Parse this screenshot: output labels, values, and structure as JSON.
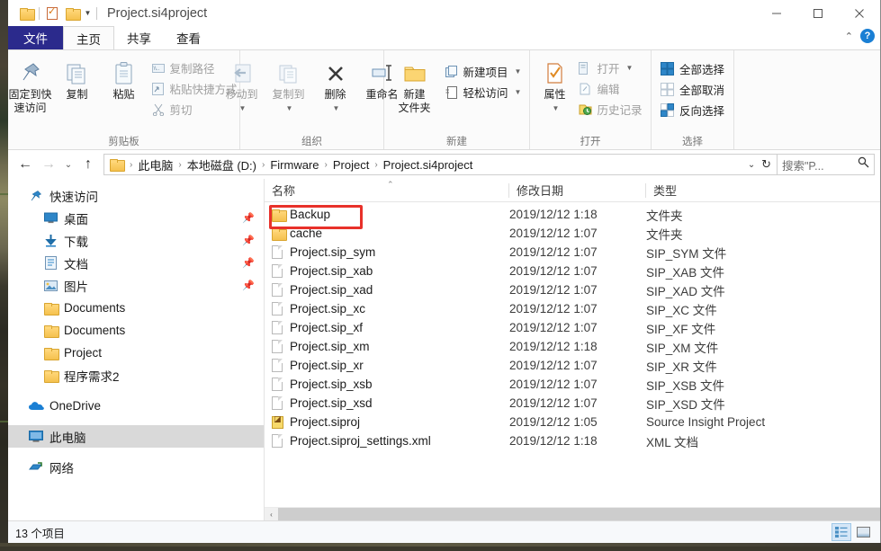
{
  "titlebar": {
    "title": "Project.si4project",
    "qat": [
      {
        "name": "folder-icon",
        "label": ""
      },
      {
        "name": "properties-icon",
        "label": ""
      },
      {
        "name": "new-folder-icon",
        "label": ""
      },
      {
        "name": "customize-caret-icon",
        "label": "▾"
      }
    ],
    "minimize": "—",
    "maximize": "□",
    "close": "✕"
  },
  "tabs": [
    {
      "label": "文件",
      "kind": "file"
    },
    {
      "label": "主页",
      "kind": "active"
    },
    {
      "label": "共享",
      "kind": "normal"
    },
    {
      "label": "查看",
      "kind": "normal"
    }
  ],
  "tabbar_right": {
    "collapse_ribbon": "⌃",
    "help": "?"
  },
  "ribbon": {
    "groups": [
      {
        "label": "剪贴板",
        "big": [
          {
            "label": "固定到快\n速访问",
            "icon": "pin-icon",
            "disabled": false
          },
          {
            "label": "复制",
            "icon": "copy-icon",
            "disabled": false
          },
          {
            "label": "粘贴",
            "icon": "paste-icon",
            "disabled": false
          }
        ],
        "small": [
          {
            "label": "复制路径",
            "icon": "copy-path-icon",
            "disabled": true
          },
          {
            "label": "粘贴快捷方式",
            "icon": "paste-shortcut-icon",
            "disabled": true
          },
          {
            "label": "剪切",
            "icon": "cut-icon",
            "disabled": true
          }
        ]
      },
      {
        "label": "组织",
        "big": [
          {
            "label": "移动到",
            "icon": "move-to-icon",
            "disabled": true,
            "caret": true
          },
          {
            "label": "复制到",
            "icon": "copy-to-icon",
            "disabled": true,
            "caret": true
          },
          {
            "label": "删除",
            "icon": "delete-icon",
            "disabled": false,
            "caret": true
          },
          {
            "label": "重命名",
            "icon": "rename-icon",
            "disabled": false
          }
        ],
        "small": []
      },
      {
        "label": "新建",
        "big": [
          {
            "label": "新建\n文件夹",
            "icon": "new-folder-icon",
            "disabled": false
          }
        ],
        "small": [
          {
            "label": "新建项目",
            "icon": "new-item-icon",
            "disabled": false,
            "caret": true
          },
          {
            "label": "轻松访问",
            "icon": "easy-access-icon",
            "disabled": false,
            "caret": true
          }
        ]
      },
      {
        "label": "打开",
        "big": [
          {
            "label": "属性",
            "icon": "properties-icon",
            "disabled": false,
            "caret": true
          }
        ],
        "small": [
          {
            "label": "打开",
            "icon": "open-icon",
            "disabled": true,
            "caret": true
          },
          {
            "label": "编辑",
            "icon": "edit-icon",
            "disabled": true
          },
          {
            "label": "历史记录",
            "icon": "history-icon",
            "disabled": true
          }
        ]
      },
      {
        "label": "选择",
        "big": [],
        "small": [
          {
            "label": "全部选择",
            "icon": "select-all-icon",
            "disabled": false
          },
          {
            "label": "全部取消",
            "icon": "select-none-icon",
            "disabled": false
          },
          {
            "label": "反向选择",
            "icon": "invert-selection-icon",
            "disabled": false
          }
        ]
      }
    ]
  },
  "addressbar": {
    "back": "←",
    "forward": "→",
    "recent": "⌄",
    "up": "↑",
    "breadcrumbs": [
      "此电脑",
      "本地磁盘 (D:)",
      "Firmware",
      "Project",
      "Project.si4project"
    ],
    "separator": "›",
    "dropdown": "⌄",
    "refresh": "↻",
    "search_placeholder": "搜索\"P...",
    "search_value": ""
  },
  "sidebar": {
    "items": [
      {
        "label": "快速访问",
        "icon": "star-icon",
        "indent": false,
        "pin": false,
        "selected": false
      },
      {
        "label": "桌面",
        "icon": "desktop-icon",
        "indent": true,
        "pin": true,
        "selected": false
      },
      {
        "label": "下载",
        "icon": "downloads-icon",
        "indent": true,
        "pin": true,
        "selected": false
      },
      {
        "label": "文档",
        "icon": "documents-icon",
        "indent": true,
        "pin": true,
        "selected": false
      },
      {
        "label": "图片",
        "icon": "pictures-icon",
        "indent": true,
        "pin": true,
        "selected": false
      },
      {
        "label": "Documents",
        "icon": "folder-icon",
        "indent": true,
        "pin": false,
        "selected": false
      },
      {
        "label": "Documents",
        "icon": "folder-icon",
        "indent": true,
        "pin": false,
        "selected": false
      },
      {
        "label": "Project",
        "icon": "folder-icon",
        "indent": true,
        "pin": false,
        "selected": false
      },
      {
        "label": "程序需求2",
        "icon": "folder-icon",
        "indent": true,
        "pin": false,
        "selected": false
      },
      {
        "label": "OneDrive",
        "icon": "onedrive-icon",
        "indent": false,
        "pin": false,
        "selected": false,
        "gap_before": true
      },
      {
        "label": "此电脑",
        "icon": "this-pc-icon",
        "indent": false,
        "pin": false,
        "selected": true,
        "gap_before": true
      },
      {
        "label": "网络",
        "icon": "network-icon",
        "indent": false,
        "pin": false,
        "selected": false,
        "gap_before": true
      }
    ]
  },
  "filelist": {
    "columns": [
      {
        "label": "名称",
        "sorted": "asc"
      },
      {
        "label": "修改日期",
        "sorted": ""
      },
      {
        "label": "类型",
        "sorted": ""
      }
    ],
    "sort_indicator": "⌃",
    "highlighted_row": "Backup",
    "rows": [
      {
        "name": "Backup",
        "date": "2019/12/12 1:18",
        "type": "文件夹",
        "icon": "folder-icon"
      },
      {
        "name": "cache",
        "date": "2019/12/12 1:07",
        "type": "文件夹",
        "icon": "folder-icon"
      },
      {
        "name": "Project.sip_sym",
        "date": "2019/12/12 1:07",
        "type": "SIP_SYM 文件",
        "icon": "file-icon"
      },
      {
        "name": "Project.sip_xab",
        "date": "2019/12/12 1:07",
        "type": "SIP_XAB 文件",
        "icon": "file-icon"
      },
      {
        "name": "Project.sip_xad",
        "date": "2019/12/12 1:07",
        "type": "SIP_XAD 文件",
        "icon": "file-icon"
      },
      {
        "name": "Project.sip_xc",
        "date": "2019/12/12 1:07",
        "type": "SIP_XC 文件",
        "icon": "file-icon"
      },
      {
        "name": "Project.sip_xf",
        "date": "2019/12/12 1:07",
        "type": "SIP_XF 文件",
        "icon": "file-icon"
      },
      {
        "name": "Project.sip_xm",
        "date": "2019/12/12 1:18",
        "type": "SIP_XM 文件",
        "icon": "file-icon"
      },
      {
        "name": "Project.sip_xr",
        "date": "2019/12/12 1:07",
        "type": "SIP_XR 文件",
        "icon": "file-icon"
      },
      {
        "name": "Project.sip_xsb",
        "date": "2019/12/12 1:07",
        "type": "SIP_XSB 文件",
        "icon": "file-icon"
      },
      {
        "name": "Project.sip_xsd",
        "date": "2019/12/12 1:07",
        "type": "SIP_XSD 文件",
        "icon": "file-icon"
      },
      {
        "name": "Project.siproj",
        "date": "2019/12/12 1:05",
        "type": "Source Insight Project",
        "icon": "siproj-icon"
      },
      {
        "name": "Project.siproj_settings.xml",
        "date": "2019/12/12 1:18",
        "type": "XML 文档",
        "icon": "file-icon"
      }
    ]
  },
  "hscroll": {
    "left_arrow": "‹"
  },
  "statusbar": {
    "item_count": "13 个项目",
    "view_details": "details-view-icon",
    "view_thumbnails": "thumbnail-view-icon"
  },
  "colors": {
    "file_tab_blue": "#2b2a8c",
    "highlight_red": "#e8312a",
    "selection_gray": "#d9d9d9",
    "accent_blue": "#1a7fd4"
  }
}
